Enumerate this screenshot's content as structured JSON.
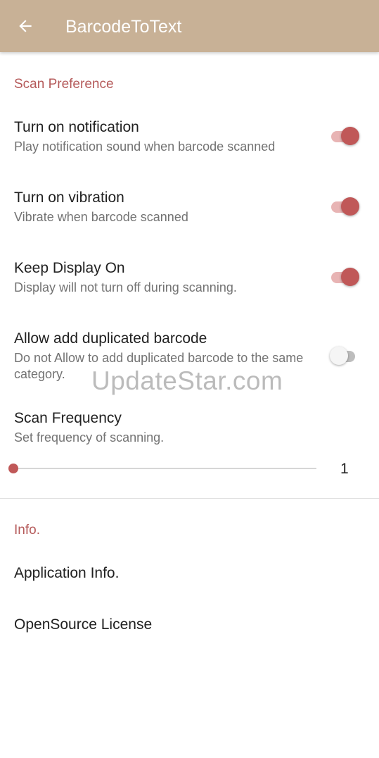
{
  "appbar": {
    "title": "BarcodeToText",
    "back_icon": "arrow-left-icon",
    "background": "#c8b196"
  },
  "accent_color": "#b55a5a",
  "sections": {
    "scan_preference": {
      "header": "Scan Preference",
      "items": [
        {
          "title": "Turn on notification",
          "summary": "Play notification sound when barcode scanned",
          "enabled": true
        },
        {
          "title": "Turn on vibration",
          "summary": "Vibrate when barcode scanned",
          "enabled": true
        },
        {
          "title": "Keep Display On",
          "summary": "Display will not turn off during scanning.",
          "enabled": true
        },
        {
          "title": "Allow add duplicated barcode",
          "summary": "Do not Allow to add duplicated barcode to the same category.",
          "enabled": false
        }
      ],
      "frequency": {
        "title": "Scan Frequency",
        "summary": "Set frequency of scanning.",
        "value": "1"
      }
    },
    "info": {
      "header": "Info.",
      "items": [
        {
          "label": "Application Info."
        },
        {
          "label": "OpenSource License"
        }
      ]
    }
  },
  "watermark": "UpdateStar.com"
}
